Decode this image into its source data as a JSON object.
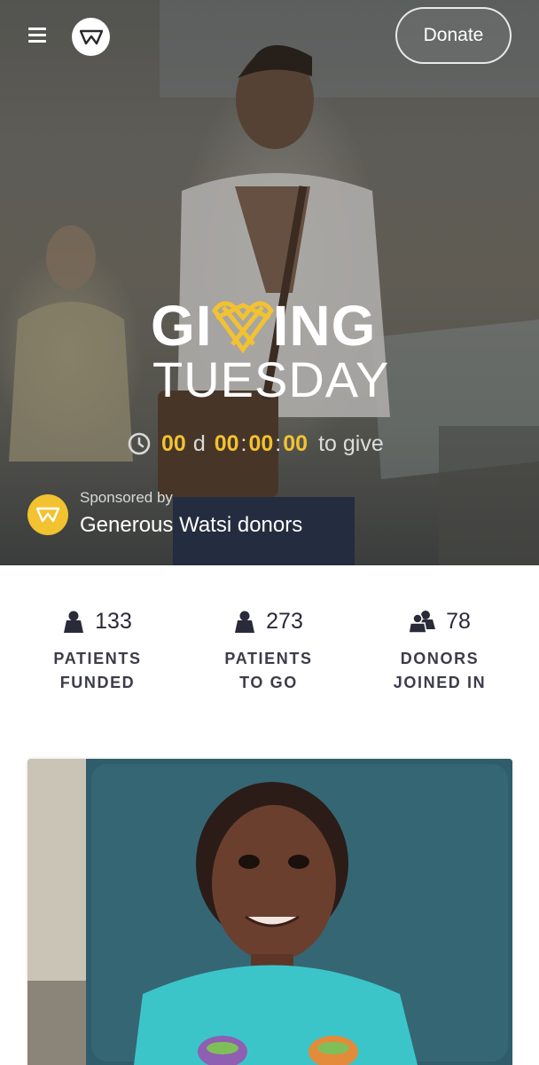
{
  "header": {
    "donate_label": "Donate"
  },
  "hero": {
    "campaign_word1_left": "GI",
    "campaign_word1_right": "ING",
    "campaign_word2": "TUESDAY",
    "countdown": {
      "days": "00",
      "days_unit": "d",
      "hours": "00",
      "minutes": "00",
      "seconds": "00",
      "suffix": "to give"
    },
    "sponsor_label": "Sponsored by",
    "sponsor_name": "Generous Watsi donors"
  },
  "stats": [
    {
      "icon": "person-icon",
      "value": "133",
      "line1": "PATIENTS",
      "line2": "FUNDED"
    },
    {
      "icon": "person-icon",
      "value": "273",
      "line1": "PATIENTS",
      "line2": "TO GO"
    },
    {
      "icon": "people-icon",
      "value": "78",
      "line1": "DONORS",
      "line2": "JOINED IN"
    }
  ],
  "colors": {
    "accent_yellow": "#f2c230",
    "text_dark": "#2a2a3a"
  }
}
